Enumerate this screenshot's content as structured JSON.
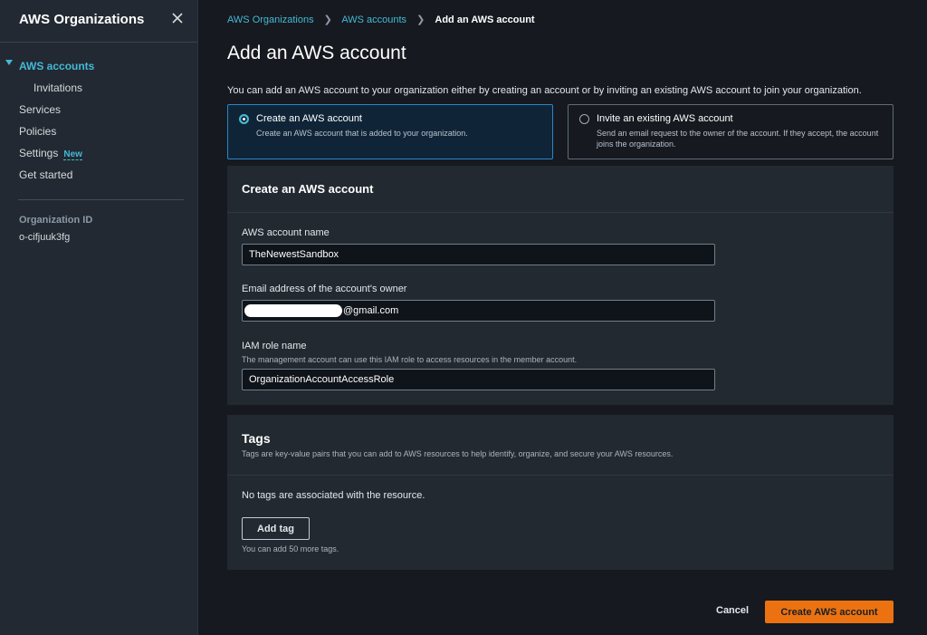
{
  "sidebar": {
    "title": "AWS Organizations",
    "close_icon": "close-icon",
    "items": [
      {
        "label": "AWS accounts"
      },
      {
        "label": "Invitations"
      },
      {
        "label": "Services"
      },
      {
        "label": "Policies"
      },
      {
        "label": "Settings",
        "badge": "New"
      },
      {
        "label": "Get started"
      }
    ],
    "org_id_label": "Organization ID",
    "org_id_value": "o-cifjuuk3fg"
  },
  "breadcrumb": {
    "items": [
      "AWS Organizations",
      "AWS accounts",
      "Add an AWS account"
    ]
  },
  "page": {
    "title": "Add an AWS account",
    "intro": "You can add an AWS account to your organization either by creating an account or by inviting an existing AWS account to join your organization."
  },
  "options": [
    {
      "title": "Create an AWS account",
      "description": "Create an AWS account that is added to your organization.",
      "selected": true
    },
    {
      "title": "Invite an existing AWS account",
      "description": "Send an email request to the owner of the account. If they accept, the account joins the organization.",
      "selected": false
    }
  ],
  "create_panel": {
    "heading": "Create an AWS account",
    "account_name": {
      "label": "AWS account name",
      "value": "TheNewestSandbox"
    },
    "email": {
      "label": "Email address of the account's owner",
      "value_visible_suffix": "@gmail.com"
    },
    "iam_role": {
      "label": "IAM role name",
      "hint": "The management account can use this IAM role to access resources in the member account.",
      "value": "OrganizationAccountAccessRole"
    }
  },
  "tags_panel": {
    "heading": "Tags",
    "description": "Tags are key-value pairs that you can add to AWS resources to help identify, organize, and secure your AWS resources.",
    "empty_text": "No tags are associated with the resource.",
    "add_tag_label": "Add tag",
    "limit_text": "You can add 50 more tags."
  },
  "footer": {
    "cancel_label": "Cancel",
    "submit_label": "Create AWS account"
  },
  "colors": {
    "accent_link": "#44b9d6",
    "primary_button": "#ec7211",
    "background": "#16191f",
    "panel": "#222930"
  }
}
